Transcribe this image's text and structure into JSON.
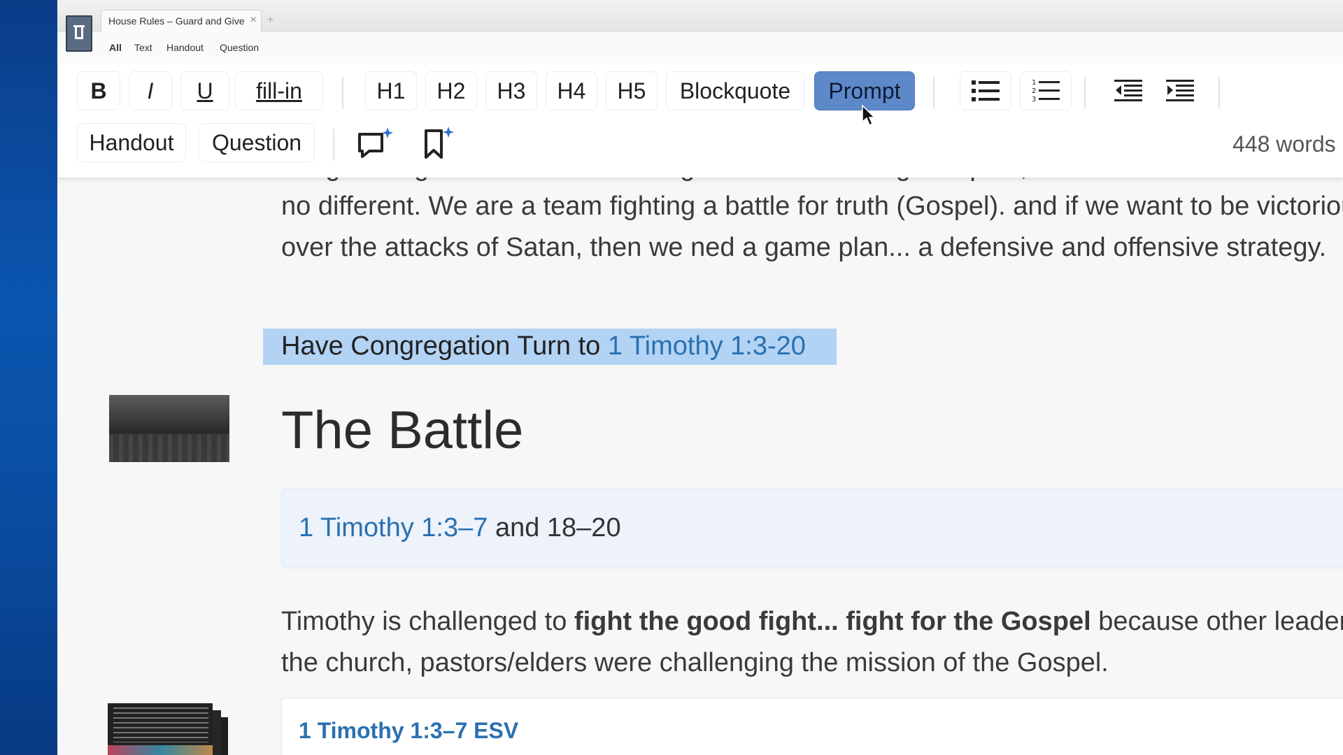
{
  "tab": {
    "title": "House Rules – Guard and Give",
    "close_icon": "×",
    "new_tab_icon": "+"
  },
  "filter_tabs": [
    "All",
    "Text",
    "Handout",
    "Question"
  ],
  "toolbar": {
    "bold": "B",
    "italic": "I",
    "underline": "U",
    "fill_in": "fill-in",
    "h1": "H1",
    "h2": "H2",
    "h3": "H3",
    "h4": "H4",
    "h5": "H5",
    "blockquote": "Blockquote",
    "prompt": "Prompt",
    "handout": "Handout",
    "question": "Question",
    "word_count": "448 words",
    "active": "Prompt"
  },
  "document": {
    "partial_line": "...a game against teams in the league — we need a game plan, the church is",
    "intro_para": "no different. We are a team fighting a battle for truth (Gospel). and if we want to be victorious over the attacks of Satan, then we ned a game plan... a defensive and offensive strategy.",
    "prompt_prefix": "Have Congregation Turn to ",
    "prompt_ref": "1 Timothy 1:3-20",
    "heading": "The Battle",
    "card_ref": "1 Timothy 1:3–7",
    "card_suffix": " and 18–20",
    "body_prefix": "Timothy is challenged to ",
    "body_bold": "fight the good fight... fight for the Gospel",
    "body_suffix": " because other leaders in the church, pastors/elders were challenging the mission of the Gospel.",
    "esv_title": "1 Timothy 1:3–7 ESV"
  }
}
